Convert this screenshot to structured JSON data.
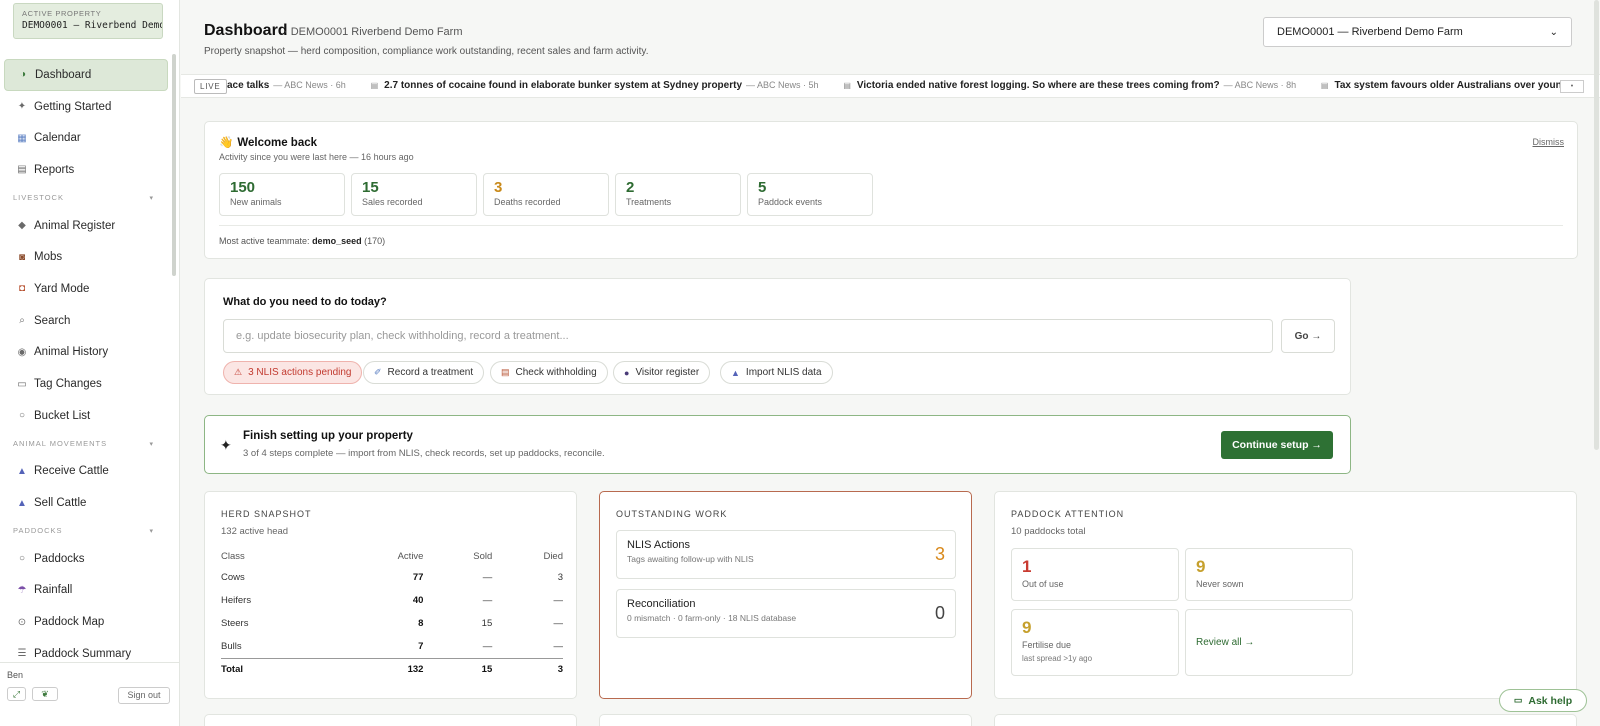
{
  "property": {
    "label": "ACTIVE PROPERTY",
    "value": "DEMO0001 — Riverbend Demo Farm"
  },
  "nav": {
    "dashboard": {
      "icon": "◑",
      "label": "Dashboard"
    },
    "getting_started": {
      "icon": "✦",
      "label": "Getting Started"
    },
    "calendar": {
      "icon": "▦",
      "label": "Calendar"
    },
    "reports": {
      "icon": "▤",
      "label": "Reports"
    },
    "livestock_header": "LIVESTOCK",
    "animal_register": {
      "icon": "◆",
      "label": "Animal Register"
    },
    "mobs": {
      "icon": "◙",
      "label": "Mobs"
    },
    "yard_mode": {
      "icon": "◘",
      "label": "Yard Mode"
    },
    "search": {
      "icon": "⌕",
      "label": "Search"
    },
    "animal_history": {
      "icon": "◉",
      "label": "Animal History"
    },
    "tag_changes": {
      "icon": "▭",
      "label": "Tag Changes"
    },
    "bucket_list": {
      "icon": "○",
      "label": "Bucket List"
    },
    "movements_header": "ANIMAL MOVEMENTS",
    "receive_cattle": {
      "icon": "▲",
      "label": "Receive Cattle"
    },
    "sell_cattle": {
      "icon": "▲",
      "label": "Sell Cattle"
    },
    "paddocks_header": "PADDOCKS",
    "paddocks": {
      "icon": "○",
      "label": "Paddocks"
    },
    "rainfall": {
      "icon": "☂",
      "label": "Rainfall"
    },
    "paddock_map": {
      "icon": "⊙",
      "label": "Paddock Map"
    },
    "paddock_summary": {
      "icon": "☰",
      "label": "Paddock Summary"
    },
    "chevron": "▾"
  },
  "footer": {
    "user": "Ben",
    "expand_icon": "⤢",
    "leaf_icon": "❦",
    "sign_out": "Sign out"
  },
  "header": {
    "title": "Dashboard",
    "subtitle": "· DEMO0001 Riverbend Demo Farm",
    "description": "Property snapshot — herd composition, compliance work outstanding, recent sales and farm activity.",
    "select_value": "DEMO0001 — Riverbend Demo Farm",
    "select_chevron": "⌄"
  },
  "ticker": {
    "live": "LIVE",
    "items": [
      {
        "headline": "ace talks",
        "source": "— ABC News · 6h"
      },
      {
        "headline": "2.7 tonnes of cocaine found in elaborate bunker system at Sydney property",
        "source": "— ABC News · 5h"
      },
      {
        "headline": "Victoria ended native forest logging. So where are these trees coming from?",
        "source": "— ABC News · 8h"
      },
      {
        "headline": "Tax system favours older Australians over younger,",
        "source": ""
      }
    ],
    "news_icon": "▤",
    "pause": "•"
  },
  "welcome": {
    "emoji": "👋",
    "title": "Welcome back",
    "since": "Activity since you were last here — 16 hours ago",
    "dismiss": "Dismiss",
    "stats": [
      {
        "value": "150",
        "label": "New animals"
      },
      {
        "value": "15",
        "label": "Sales recorded"
      },
      {
        "value": "3",
        "label": "Deaths recorded"
      },
      {
        "value": "2",
        "label": "Treatments"
      },
      {
        "value": "5",
        "label": "Paddock events"
      }
    ],
    "teammate_prefix": "Most active teammate:",
    "teammate_name": "demo_seed",
    "teammate_count": "(170)"
  },
  "todo": {
    "question": "What do you need to do today?",
    "placeholder": "e.g. update biosecurity plan, check withholding, record a treatment...",
    "go": "Go →",
    "chips": [
      {
        "icon": "⚠",
        "label": "3 NLIS actions pending"
      },
      {
        "icon": "✐",
        "label": "Record a treatment"
      },
      {
        "icon": "▤",
        "label": "Check withholding"
      },
      {
        "icon": "●",
        "label": "Visitor register"
      },
      {
        "icon": "▲",
        "label": "Import NLIS data"
      }
    ]
  },
  "setup": {
    "icon": "✦",
    "title": "Finish setting up your property",
    "subtitle": "3 of 4 steps complete — import from NLIS, check records, set up paddocks, reconcile.",
    "button": "Continue setup →"
  },
  "herd": {
    "heading": "HERD SNAPSHOT",
    "sub": "132 active head",
    "columns": [
      "Class",
      "Active",
      "Sold",
      "Died"
    ],
    "rows": [
      [
        "Cows",
        "77",
        "—",
        "3"
      ],
      [
        "Heifers",
        "40",
        "—",
        "—"
      ],
      [
        "Steers",
        "8",
        "15",
        "—"
      ],
      [
        "Bulls",
        "7",
        "—",
        "—"
      ]
    ],
    "total": [
      "Total",
      "132",
      "15",
      "3"
    ]
  },
  "outstanding": {
    "heading": "OUTSTANDING WORK",
    "items": [
      {
        "title": "NLIS Actions",
        "sub": "Tags awaiting follow-up with NLIS",
        "value": "3"
      },
      {
        "title": "Reconciliation",
        "sub": "0 mismatch · 0 farm-only · 18 NLIS database",
        "value": "0"
      }
    ]
  },
  "paddock": {
    "heading": "PADDOCK ATTENTION",
    "sub": "10 paddocks total",
    "boxes": [
      {
        "value": "1",
        "label": "Out of use"
      },
      {
        "value": "9",
        "label": "Never sown"
      },
      {
        "value": "9",
        "label": "Fertilise due",
        "note": "last spread >1y ago"
      }
    ],
    "review": "Review all →"
  },
  "ask_help": {
    "icon": "▭",
    "label": "Ask help"
  },
  "colors": {
    "brand_green": "#2e7134",
    "active_nav": "#dde8d8",
    "alert_red": "#c23b30",
    "warn_amber": "#d8891b",
    "outstanding_border": "#b86a4f"
  }
}
